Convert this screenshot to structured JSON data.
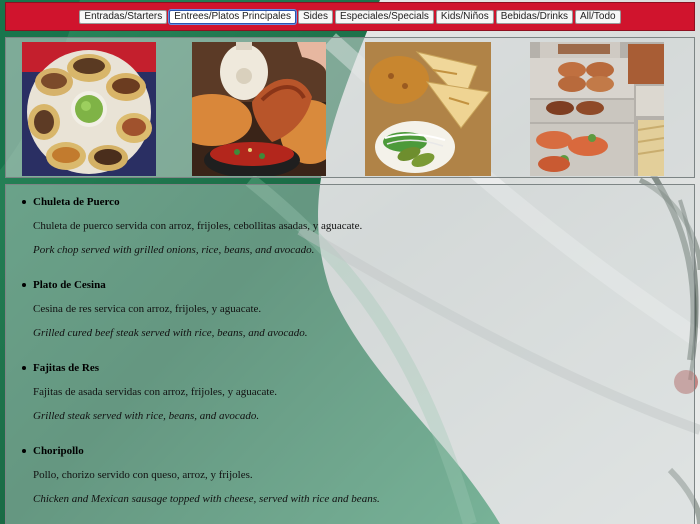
{
  "nav": {
    "items": [
      {
        "label": "Entradas/Starters",
        "active": false
      },
      {
        "label": "Entrees/Platos Principales",
        "active": true
      },
      {
        "label": "Sides",
        "active": false
      },
      {
        "label": "Especiales/Specials",
        "active": false
      },
      {
        "label": "Kids/Niños",
        "active": false
      },
      {
        "label": "Bebidas/Drinks",
        "active": false
      },
      {
        "label": "All/Todo",
        "active": false
      }
    ]
  },
  "photos": [
    {
      "subject": "platter of tacos around guacamole"
    },
    {
      "subject": "fried chicken dipped in salsa"
    },
    {
      "subject": "quesadillas with rice and avocado"
    },
    {
      "subject": "trays of prepared food"
    }
  ],
  "menu": {
    "dishes": [
      {
        "name": "Chuleta de Puerco",
        "description_es": "Chuleta de puerco servida con arroz, frijoles, cebollitas asadas, y aguacate.",
        "description_en": "Pork chop served with grilled onions, rice, beans, and avocado."
      },
      {
        "name": "Plato de Cesina",
        "description_es": "Cesina de res servica con arroz, frijoles, y aguacate.",
        "description_en": "Grilled cured beef steak served with rice, beans, and avocado."
      },
      {
        "name": "Fajitas de Res",
        "description_es": "Fajitas de asada servidas con arroz, frijoles, y aguacate.",
        "description_en": "Grilled steak served with rice, beans, and avocado."
      },
      {
        "name": "Choripollo",
        "description_es": "Pollo, chorizo servido con queso, arroz, y frijoles.",
        "description_en": "Chicken and Mexican sausage topped with cheese, served with rice and beans."
      }
    ]
  },
  "colors": {
    "nav_red": "#d0142d",
    "flag_green": "#1f7a50",
    "flag_white": "#eef0ef"
  }
}
